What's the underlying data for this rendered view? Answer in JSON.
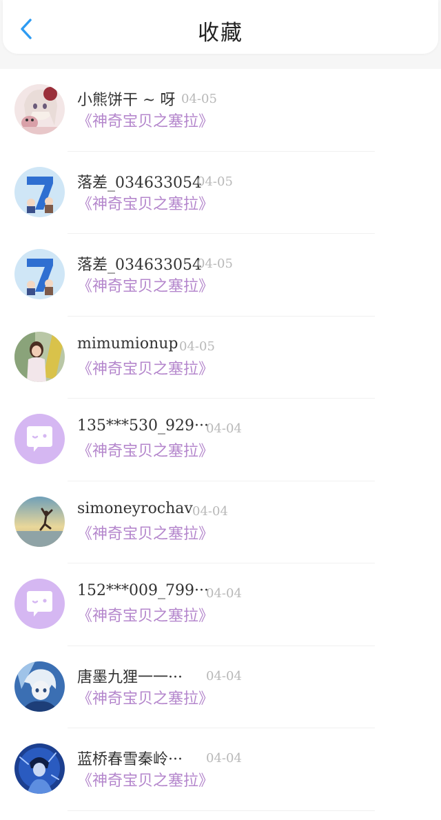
{
  "header": {
    "title": "收藏",
    "back_icon": "chevron-left-icon",
    "accent": "#2e9bf2"
  },
  "colors": {
    "book_title": "#b486cc",
    "date": "#b8b8b8",
    "name": "#333333",
    "chat_avatar_bg": "#d5b7f2"
  },
  "items": [
    {
      "name": "小熊饼干 ~ 呀",
      "date": "04-05",
      "book": "《神奇宝贝之塞拉》",
      "avatar": "anime-girl-pink-avatar"
    },
    {
      "name": "落差_034633054",
      "date": "04-05",
      "book": "《神奇宝贝之塞拉》",
      "avatar": "number-seven-avatar"
    },
    {
      "name": "落差_034633054",
      "date": "04-05",
      "book": "《神奇宝贝之塞拉》",
      "avatar": "number-seven-avatar"
    },
    {
      "name": "mimumionup",
      "date": "04-05",
      "book": "《神奇宝贝之塞拉》",
      "avatar": "photo-girl-avatar"
    },
    {
      "name": "135***530_929···",
      "date": "04-04",
      "book": "《神奇宝贝之塞拉》",
      "avatar": "chat-bubble-avatar"
    },
    {
      "name": "simoneyrochav",
      "date": "04-04",
      "book": "《神奇宝贝之塞拉》",
      "avatar": "sunset-jump-avatar"
    },
    {
      "name": "152***009_799···",
      "date": "04-04",
      "book": "《神奇宝贝之塞拉》",
      "avatar": "chat-bubble-avatar"
    },
    {
      "name": "唐墨九狸一一···",
      "date": "04-04",
      "book": "《神奇宝贝之塞拉》",
      "avatar": "anime-boy-blue-avatar"
    },
    {
      "name": "蓝桥春雪秦岭···",
      "date": "04-04",
      "book": "《神奇宝贝之塞拉》",
      "avatar": "anime-dark-blue-avatar"
    }
  ]
}
